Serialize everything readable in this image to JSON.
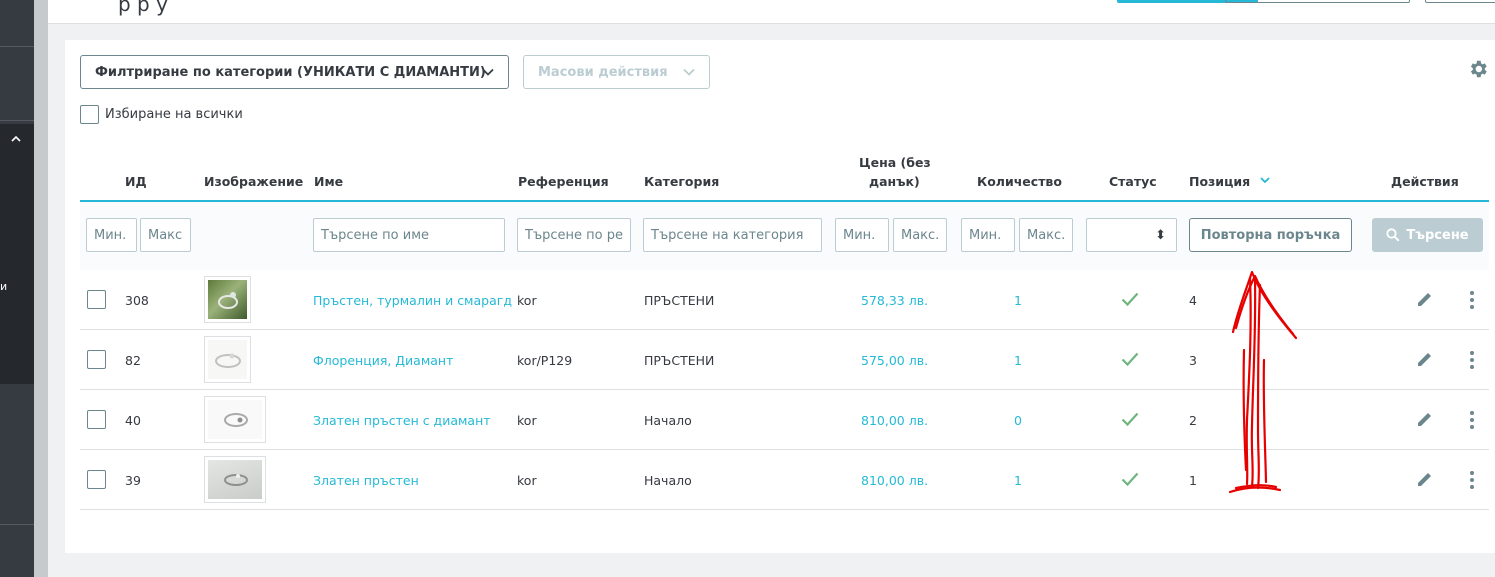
{
  "header": {
    "title_fragment": "р  р у"
  },
  "sidebar": {
    "fragment": "и"
  },
  "toolbar": {
    "category_filter_label": "Филтриране по категории (УНИКАТИ С ДИАМАНТИ)",
    "bulk_actions_label": "Масови действия",
    "select_all_label": "Избиране на всички"
  },
  "table": {
    "columns": {
      "id": "ИД",
      "image": "Изображение",
      "name": "Име",
      "reference": "Референция",
      "category": "Категория",
      "price_line1": "Цена (без",
      "price_line2": "данък)",
      "quantity": "Количество",
      "status": "Статус",
      "position": "Позиция",
      "actions": "Действия"
    },
    "filters": {
      "id_min": "Мин.",
      "id_max": "Макс",
      "name": "Търсене по име",
      "reference": "Търсене по ре",
      "category": "Търсене на категория",
      "price_min": "Мин.",
      "price_max": "Макс.",
      "qty_min": "Мин.",
      "qty_max": "Макс.",
      "status_arrow": "⬍",
      "reorder_label": "Повторна поръчка",
      "search_label": "Търсене"
    },
    "rows": [
      {
        "id": "308",
        "name": "Пръстен, турмалин и смарагд",
        "reference": "kor",
        "category": "ПРЪСТЕНИ",
        "price": "578,33 лв.",
        "quantity": "1",
        "position": "4"
      },
      {
        "id": "82",
        "name": "Флоренция, Диамант",
        "reference": "kor/P129",
        "category": "ПРЪСТЕНИ",
        "price": "575,00 лв.",
        "quantity": "1",
        "position": "3"
      },
      {
        "id": "40",
        "name": "Златен пръстен с диамант",
        "reference": "kor",
        "category": "Начало",
        "price": "810,00 лв.",
        "quantity": "0",
        "position": "2"
      },
      {
        "id": "39",
        "name": "Златен пръстен",
        "reference": "kor",
        "category": "Начало",
        "price": "810,00 лв.",
        "quantity": "1",
        "position": "1"
      }
    ]
  },
  "colors": {
    "accent": "#25b9d7",
    "status_ok": "#70b580",
    "annotation": "#e60000",
    "sidebar": "#363a41"
  },
  "icons": [
    "chevron-down-icon",
    "gear-icon",
    "search-icon",
    "check-icon",
    "pencil-icon",
    "more-vertical-icon",
    "sort-down-icon"
  ]
}
